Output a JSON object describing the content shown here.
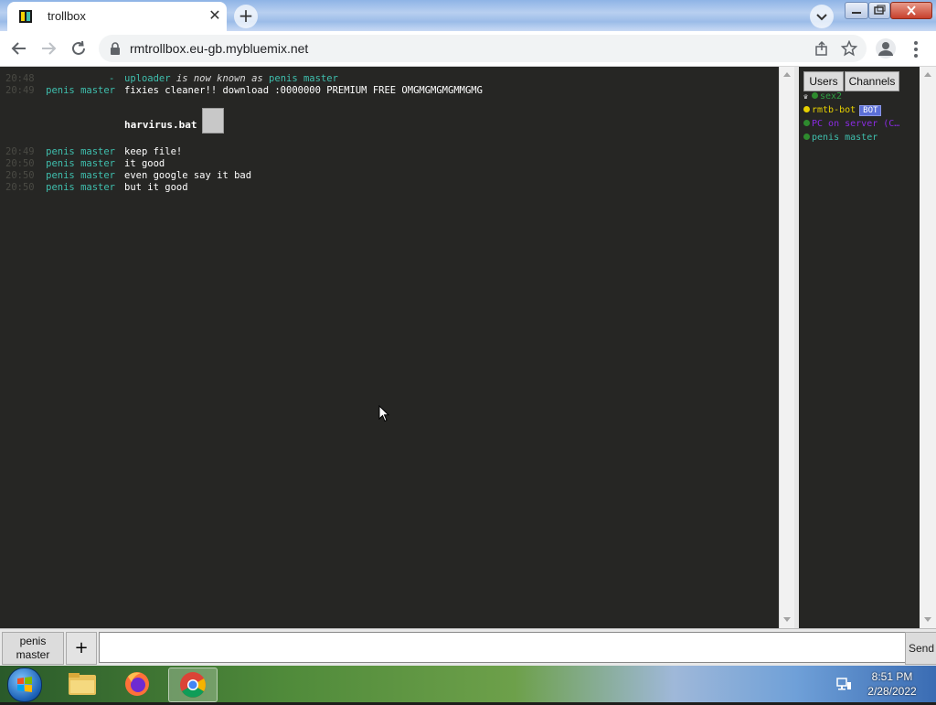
{
  "browser": {
    "tab_title": "trollbox",
    "url": "rmtrollbox.eu-gb.mybluemix.net"
  },
  "chat": {
    "system_message": {
      "time": "20:48",
      "dash": "-",
      "old_name": "uploader",
      "middle": " is now known as ",
      "new_name": "penis master"
    },
    "messages": [
      {
        "time": "20:49",
        "nick": "penis master",
        "text": "fixies cleaner!! download :0000000 PREMIUM FREE OMGMGMGMGMMGMG"
      },
      {
        "time": "20:49",
        "nick": "penis master",
        "text": "keep file!"
      },
      {
        "time": "20:50",
        "nick": "penis master",
        "text": "it good"
      },
      {
        "time": "20:50",
        "nick": "penis master",
        "text": "even google say it bad"
      },
      {
        "time": "20:50",
        "nick": "penis master",
        "text": "but it good"
      }
    ],
    "attachment": {
      "filename": "harvirus.bat"
    }
  },
  "side_panel": {
    "tabs": [
      "Users",
      "Channels"
    ],
    "users": [
      {
        "name": "sex2",
        "color": "#2ea043",
        "dot": "#2e8b2e",
        "crown": true
      },
      {
        "name": "rmtb-bot",
        "color": "#e6d000",
        "dot": "#e6d000",
        "badge": "BOT"
      },
      {
        "name": "PC on server (C…",
        "color": "#8a2be2",
        "dot": "#2e8b2e"
      },
      {
        "name": "penis master",
        "color": "#3fbfae",
        "dot": "#2e8b2e"
      }
    ]
  },
  "input": {
    "nick_label": "penis master",
    "add_label": "+",
    "placeholder": "",
    "send_label": "Send"
  },
  "taskbar": {
    "time": "8:51 PM",
    "date": "2/28/2022"
  }
}
